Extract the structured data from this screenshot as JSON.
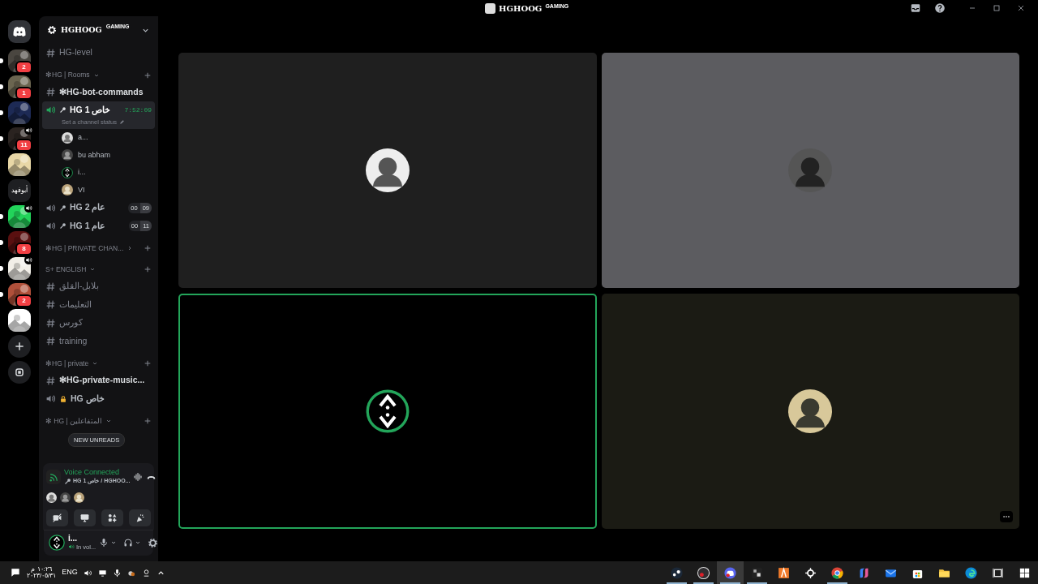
{
  "window": {
    "title": "HGHOOG",
    "title_tag": "GAMING"
  },
  "servers": [
    {
      "kind": "home",
      "unread": false
    },
    {
      "kind": "avatar",
      "color": "#4a4640",
      "badge": "2",
      "speaker": false,
      "unread": true
    },
    {
      "kind": "avatar",
      "color": "#6b6550",
      "badge": "1",
      "speaker": false,
      "unread": true
    },
    {
      "kind": "avatar",
      "color": "#1d2a55",
      "speaker": false,
      "unread": true
    },
    {
      "kind": "avatar",
      "color": "#2a2320",
      "badge": "11",
      "speaker": true,
      "unread": true
    },
    {
      "kind": "avatar",
      "color": "#e8d7a6",
      "speaker": false,
      "unread": false
    },
    {
      "kind": "label",
      "label": "أبوفهد",
      "unread": false
    },
    {
      "kind": "avatar",
      "color": "#22d45a",
      "speaker": true,
      "unread": true
    },
    {
      "kind": "avatar",
      "color": "#5a1010",
      "badge": "8",
      "speaker": false,
      "unread": true
    },
    {
      "kind": "avatar",
      "color": "#f2efe8",
      "speaker": true,
      "unread": true
    },
    {
      "kind": "avatar",
      "color": "#b0503a",
      "badge": "2",
      "speaker": false,
      "unread": true
    },
    {
      "kind": "avatar",
      "color": "#ffffff",
      "speaker": false,
      "unread": false
    },
    {
      "kind": "add"
    },
    {
      "kind": "discover"
    }
  ],
  "server_header": {
    "name": "HGHOOG",
    "tag": "GAMING"
  },
  "channels": [
    {
      "kind": "text",
      "name": "HG-level",
      "unread": false
    },
    {
      "kind": "category",
      "name": "✻HG | Rooms",
      "expanded": true
    },
    {
      "kind": "text",
      "name": "✻HG-bot-commands",
      "unread": true
    },
    {
      "kind": "voice",
      "name": "HG 1 خاص",
      "selected": true,
      "timer": "7:52:09",
      "status": "Set a channel status",
      "users": [
        {
          "name": "a..."
        },
        {
          "name": "bu abham"
        },
        {
          "name": "i..."
        },
        {
          "name": "VI"
        }
      ]
    },
    {
      "kind": "voice",
      "name": "HG 2 عام",
      "selected": false,
      "counts": {
        "current": "00",
        "limit": "09"
      }
    },
    {
      "kind": "voice",
      "name": "HG 1 عام",
      "selected": false,
      "counts": {
        "current": "00",
        "limit": "11"
      }
    },
    {
      "kind": "category",
      "name": "✻HG | PRIVATE CHAN...",
      "expanded": false
    },
    {
      "kind": "category",
      "name": "S+ ENGLISH",
      "expanded": true
    },
    {
      "kind": "text",
      "name": "بلابل-القلق",
      "unread": false
    },
    {
      "kind": "text",
      "name": "التعليمات",
      "unread": false
    },
    {
      "kind": "text",
      "name": "كورس",
      "unread": false
    },
    {
      "kind": "text",
      "name": "training",
      "unread": false
    },
    {
      "kind": "category",
      "name": "✻HG | private",
      "expanded": true
    },
    {
      "kind": "text",
      "name": "✻HG-private-music...",
      "unread": true
    },
    {
      "kind": "voice",
      "name": "HG خاص",
      "selected": false,
      "locked": true
    },
    {
      "kind": "category",
      "name": "✻ HG | المتفاعلين",
      "expanded": true
    }
  ],
  "new_unreads": "NEW UNREADS",
  "voice_panel": {
    "title": "Voice Connected",
    "location": "HG 1 خاص / HGHOO..."
  },
  "user_panel": {
    "name": "i...",
    "status": "In vol..."
  },
  "tiles": [
    {
      "color": "#1f1f1f",
      "speaking": false,
      "more": false
    },
    {
      "color": "#5c5c60",
      "speaking": false,
      "more": false
    },
    {
      "color": "#000000",
      "speaking": true,
      "more": false
    },
    {
      "color": "#1b1b14",
      "speaking": false,
      "more": true
    }
  ],
  "taskbar": {
    "time": "١٠:٢٦ م",
    "date": "٢٠٢٣/٠٥/٣١",
    "language": "ENG",
    "apps": [
      {
        "kind": "steam",
        "running": true,
        "selected": false
      },
      {
        "kind": "obs",
        "running": true,
        "selected": false
      },
      {
        "kind": "discord",
        "running": true,
        "selected": true
      },
      {
        "kind": "bm",
        "running": true,
        "selected": false
      },
      {
        "kind": "orange",
        "running": false,
        "selected": false
      },
      {
        "kind": "steelseries",
        "running": false,
        "selected": false
      },
      {
        "kind": "chrome",
        "running": true,
        "selected": false
      },
      {
        "kind": "copilot",
        "running": false,
        "selected": false
      },
      {
        "kind": "mail",
        "running": false,
        "selected": false
      },
      {
        "kind": "store",
        "running": false,
        "selected": false
      },
      {
        "kind": "folder",
        "running": false,
        "selected": false
      },
      {
        "kind": "edge",
        "running": false,
        "selected": false
      },
      {
        "kind": "taskview",
        "running": false,
        "selected": false
      },
      {
        "kind": "start",
        "running": false,
        "selected": false
      }
    ]
  }
}
